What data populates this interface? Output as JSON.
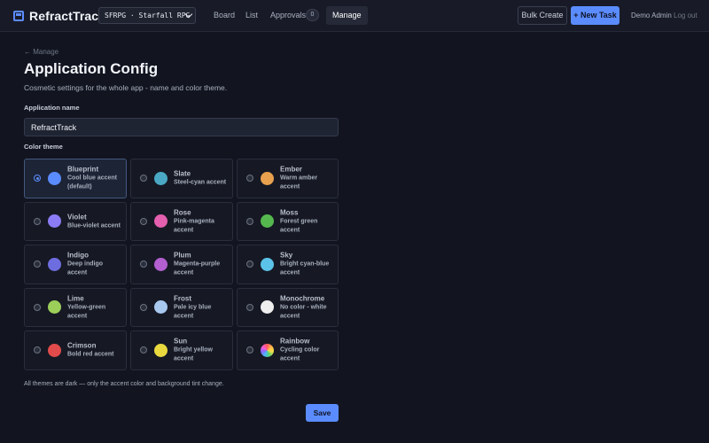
{
  "header": {
    "brand_title": "RefractTrack",
    "project_select": "SFRPG · Starfall RPG",
    "nav": {
      "board": "Board",
      "list": "List",
      "approvals": "Approvals",
      "approvals_count": "0",
      "manage": "Manage"
    },
    "bulk_create": "Bulk Create",
    "new_task": "+ New Task",
    "user_name": "Demo Admin",
    "logout": "Log out"
  },
  "page": {
    "back_link": "← Manage",
    "title": "Application Config",
    "subtitle": "Cosmetic settings for the whole app - name and color theme.",
    "app_name_label": "Application name",
    "app_name_value": "RefractTrack",
    "color_theme_label": "Color theme",
    "footer_note": "All themes are dark — only the accent color and background tint change.",
    "save_label": "Save"
  },
  "themes": [
    {
      "name": "Blueprint",
      "desc": "Cool blue accent (default)",
      "color": "#5b8cff",
      "selected": true
    },
    {
      "name": "Slate",
      "desc": "Steel-cyan accent",
      "color": "#4aa8c4",
      "selected": false
    },
    {
      "name": "Ember",
      "desc": "Warm amber accent",
      "color": "#e8a14e",
      "selected": false
    },
    {
      "name": "Violet",
      "desc": "Blue-violet accent",
      "color": "#8b7cf6",
      "selected": false
    },
    {
      "name": "Rose",
      "desc": "Pink-magenta accent",
      "color": "#e45fae",
      "selected": false
    },
    {
      "name": "Moss",
      "desc": "Forest green accent",
      "color": "#55b84f",
      "selected": false
    },
    {
      "name": "Indigo",
      "desc": "Deep indigo accent",
      "color": "#6e6de0",
      "selected": false
    },
    {
      "name": "Plum",
      "desc": "Magenta-purple accent",
      "color": "#b35fd0",
      "selected": false
    },
    {
      "name": "Sky",
      "desc": "Bright cyan-blue accent",
      "color": "#5cc3e8",
      "selected": false
    },
    {
      "name": "Lime",
      "desc": "Yellow-green accent",
      "color": "#9ccf5a",
      "selected": false
    },
    {
      "name": "Frost",
      "desc": "Pale icy blue accent",
      "color": "#a9c8ee",
      "selected": false
    },
    {
      "name": "Monochrome",
      "desc": "No color - white accent",
      "color": "#eeeeee",
      "selected": false
    },
    {
      "name": "Crimson",
      "desc": "Bold red accent",
      "color": "#e24b4b",
      "selected": false
    },
    {
      "name": "Sun",
      "desc": "Bright yellow accent",
      "color": "#e9d93f",
      "selected": false
    },
    {
      "name": "Rainbow",
      "desc": "Cycling color accent",
      "color": "rainbow",
      "selected": false
    }
  ]
}
